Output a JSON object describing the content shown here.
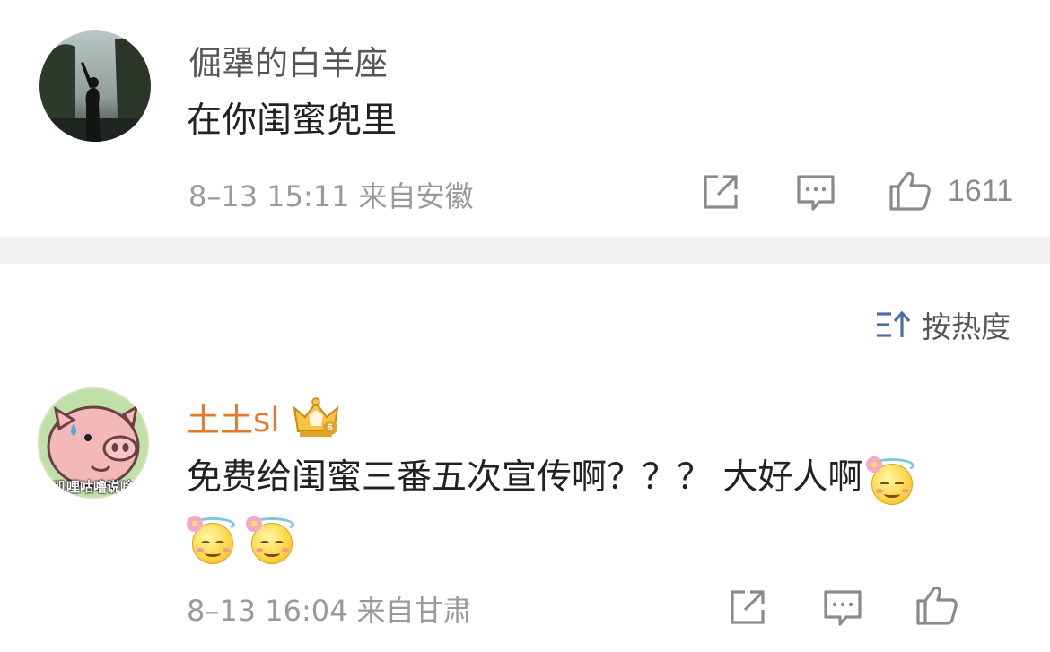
{
  "comments": [
    {
      "username": "倔犟的白羊座",
      "text": "在你闺蜜兜里",
      "time": "8–13 15:11",
      "source": "来自安徽",
      "likes": "1611"
    },
    {
      "username": "土土sl",
      "badge": "6",
      "text_line1": "免费给闺蜜三番五次宣传啊？？？ 大好人啊",
      "time": "8–13 16:04",
      "source": "来自甘肃",
      "avatar_caption": "叽哩咕噜说啥",
      "emoji_name": "angel-smile-emoji"
    }
  ],
  "sort": {
    "label": "按热度"
  },
  "colors": {
    "vip_name": "#e8792a",
    "meta_gray": "#9a9a9a",
    "divider": "#f2f2f2"
  }
}
